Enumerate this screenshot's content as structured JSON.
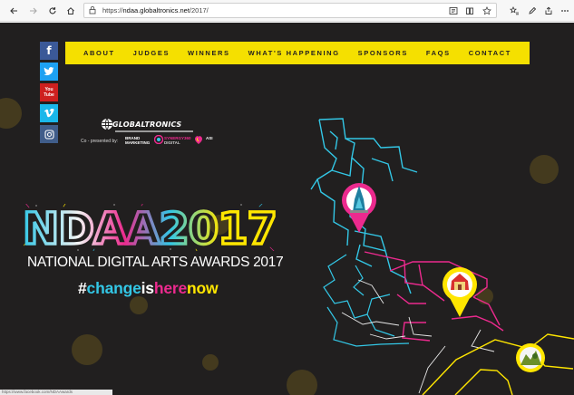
{
  "browser": {
    "url_prefix": "https://",
    "url_host": "ndaa.globaltronics.net",
    "url_path": "/2017/"
  },
  "nav": {
    "items": [
      "ABOUT",
      "JUDGES",
      "WINNERS",
      "WHAT'S HAPPENING",
      "SPONSORS",
      "FAQS",
      "CONTACT"
    ]
  },
  "social": {
    "facebook": "f",
    "youtube": "You Tube"
  },
  "brand": {
    "name": "GLOBALTRONICS",
    "copresented": "Co - presented by:",
    "sponsors": [
      {
        "line1": "BRAND",
        "line2": "MARKETING"
      },
      {
        "line1": "SYNERGY360",
        "line2": "DIGITAL"
      },
      {
        "line1": "ASI",
        "line2": ""
      }
    ]
  },
  "hero": {
    "logo_text": "NDAA2017",
    "subtitle": "NATIONAL DIGITAL ARTS AWARDS 2017",
    "hashtag": {
      "part1": "#",
      "part2": "change",
      "part3": "is",
      "part4": "here",
      "part5": "now"
    }
  },
  "status_text": "https://www.facebook.com/NDAAwards",
  "colors": {
    "background": "#211f1f",
    "yellow": "#f5e000",
    "cyan": "#33c7e6",
    "magenta": "#ec2a8e",
    "facebook": "#3b5998",
    "twitter": "#1da1f2",
    "youtube": "#cd201f",
    "vimeo": "#1ab7ea",
    "instagram": "#405d8a"
  }
}
